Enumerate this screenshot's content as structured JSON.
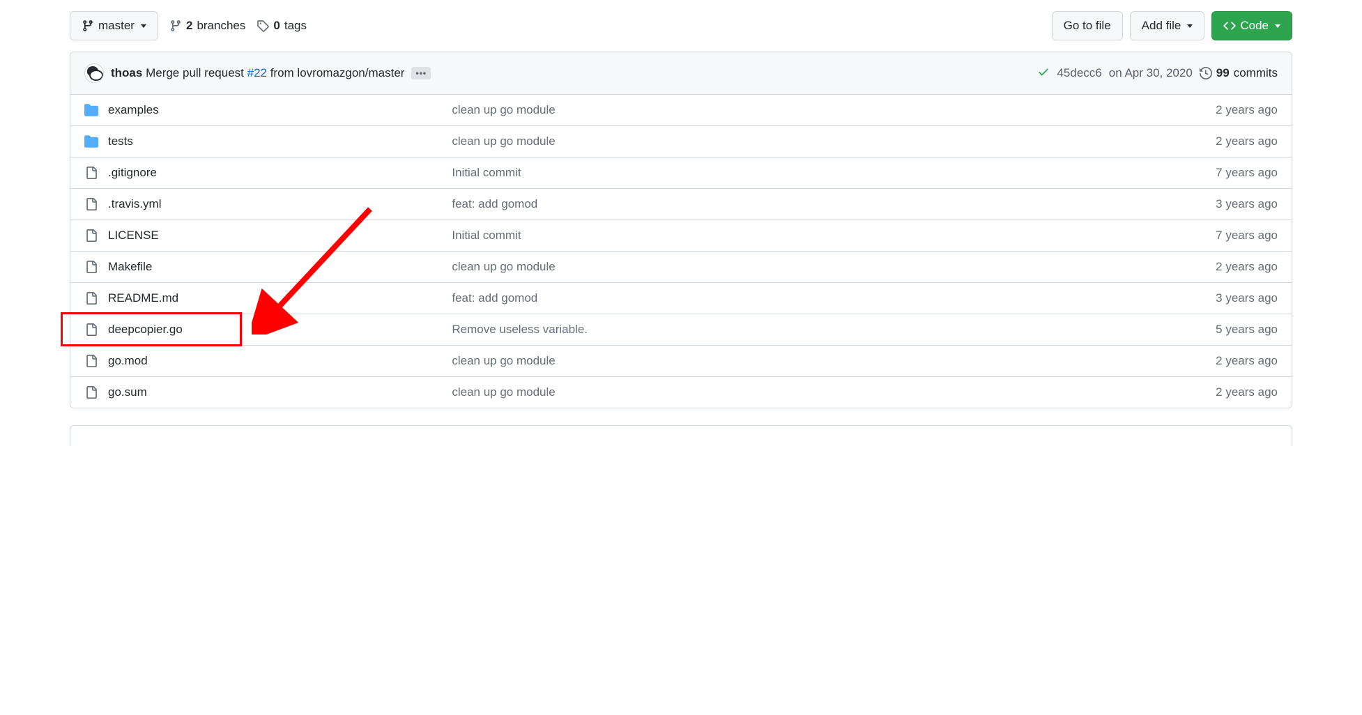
{
  "toolbar": {
    "branch_label": "master",
    "branches_count": "2",
    "branches_text": "branches",
    "tags_count": "0",
    "tags_text": "tags",
    "go_to_file": "Go to file",
    "add_file": "Add file",
    "code": "Code"
  },
  "commit": {
    "author": "thoas",
    "message_prefix": "Merge pull request ",
    "pr_ref": "#22",
    "message_suffix": " from lovromazgon/master",
    "sha": "45decc6",
    "date": "on Apr 30, 2020",
    "commits_count": "99",
    "commits_text": "commits"
  },
  "files": [
    {
      "type": "folder",
      "name": "examples",
      "msg": "clean up go module",
      "age": "2 years ago"
    },
    {
      "type": "folder",
      "name": "tests",
      "msg": "clean up go module",
      "age": "2 years ago"
    },
    {
      "type": "file",
      "name": ".gitignore",
      "msg": "Initial commit",
      "age": "7 years ago"
    },
    {
      "type": "file",
      "name": ".travis.yml",
      "msg": "feat: add gomod",
      "age": "3 years ago"
    },
    {
      "type": "file",
      "name": "LICENSE",
      "msg": "Initial commit",
      "age": "7 years ago"
    },
    {
      "type": "file",
      "name": "Makefile",
      "msg": "clean up go module",
      "age": "2 years ago"
    },
    {
      "type": "file",
      "name": "README.md",
      "msg": "feat: add gomod",
      "age": "3 years ago"
    },
    {
      "type": "file",
      "name": "deepcopier.go",
      "msg": "Remove useless variable.",
      "age": "5 years ago"
    },
    {
      "type": "file",
      "name": "go.mod",
      "msg": "clean up go module",
      "age": "2 years ago"
    },
    {
      "type": "file",
      "name": "go.sum",
      "msg": "clean up go module",
      "age": "2 years ago"
    }
  ]
}
